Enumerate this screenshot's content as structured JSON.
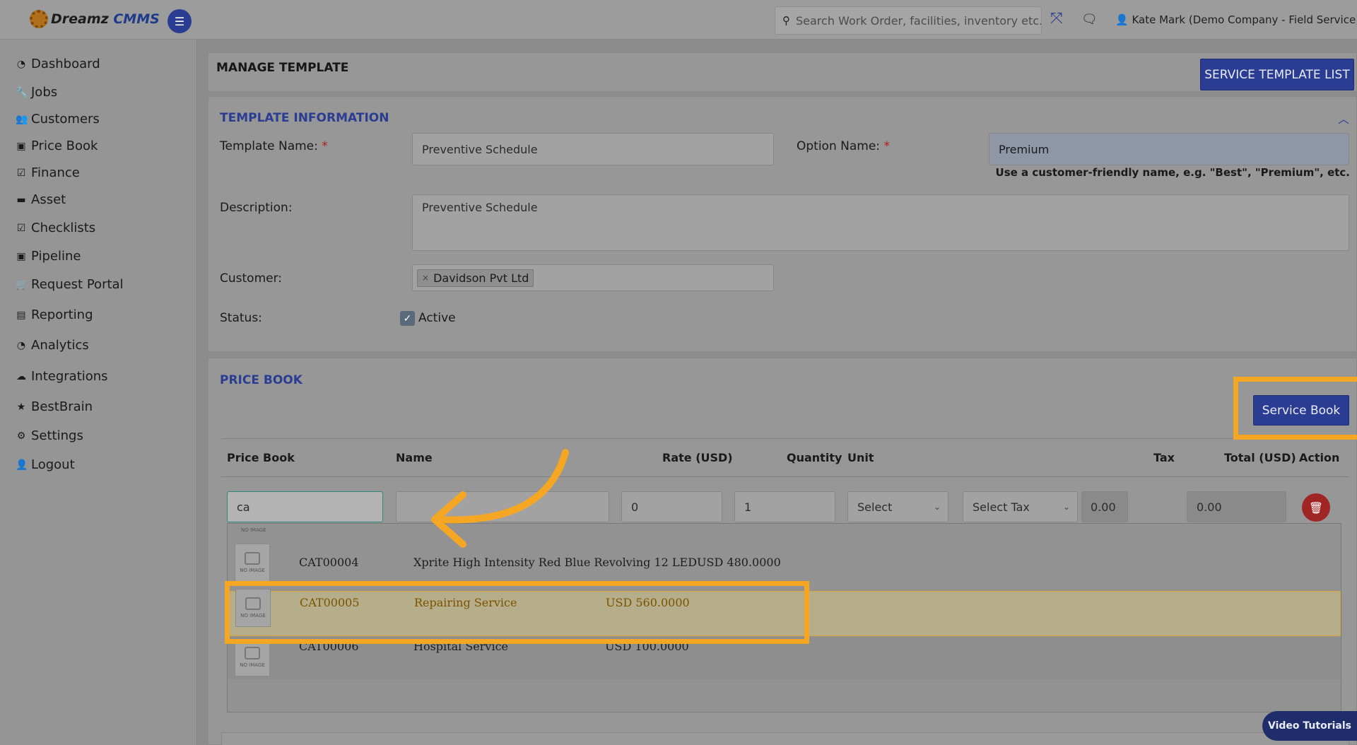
{
  "header": {
    "logo_main": "Dreamz",
    "logo_sub": "CMMS",
    "search_placeholder": "Search Work Order, facilities, inventory etc...",
    "user": "Kate Mark (Demo Company - Field Service)"
  },
  "sidebar": {
    "items": [
      {
        "label": "Dashboard",
        "icon": "dashboard-icon"
      },
      {
        "label": "Jobs",
        "icon": "wrench-icon"
      },
      {
        "label": "Customers",
        "icon": "users-icon"
      },
      {
        "label": "Price Book",
        "icon": "money-icon"
      },
      {
        "label": "Finance",
        "icon": "check-square-icon"
      },
      {
        "label": "Asset",
        "icon": "archive-icon"
      },
      {
        "label": "Checklists",
        "icon": "check-square-icon"
      },
      {
        "label": "Pipeline",
        "icon": "money-icon"
      },
      {
        "label": "Request Portal",
        "icon": "cart-icon"
      },
      {
        "label": "Reporting",
        "icon": "file-icon"
      },
      {
        "label": "Analytics",
        "icon": "dashboard-icon"
      },
      {
        "label": "Integrations",
        "icon": "cloud-icon"
      },
      {
        "label": "BestBrain",
        "icon": "star-icon"
      },
      {
        "label": "Settings",
        "icon": "gear-icon"
      },
      {
        "label": "Logout",
        "icon": "user-icon"
      }
    ]
  },
  "page": {
    "title": "MANAGE TEMPLATE",
    "list_button": "SERVICE TEMPLATE LIST"
  },
  "template_info": {
    "section_title": "TEMPLATE INFORMATION",
    "template_name_label": "Template Name:",
    "template_name_value": "Preventive Schedule",
    "option_name_label": "Option Name:",
    "option_name_value": "Premium",
    "option_hint": "Use a customer-friendly name, e.g. \"Best\", \"Premium\", etc.",
    "description_label": "Description:",
    "description_value": "Preventive Schedule",
    "customer_label": "Customer:",
    "customer_chip": "Davidson Pvt Ltd",
    "status_label": "Status:",
    "status_value": "Active",
    "required_mark": "*"
  },
  "price_book": {
    "section_title": "PRICE BOOK",
    "service_book_button": "Service Book",
    "columns": [
      "Price Book",
      "Name",
      "Rate (USD)",
      "Quantity",
      "Unit",
      "Tax",
      "Total (USD)",
      "Action"
    ],
    "row": {
      "price_book_input": "ca",
      "name_input": "",
      "rate": "0",
      "quantity": "1",
      "unit": "Select",
      "tax": "Select Tax",
      "tax_amount": "0.00",
      "total": "0.00"
    },
    "suggestions": [
      {
        "code": "CAT00004",
        "name": "Xprite High Intensity Red Blue Revolving 12 LED",
        "price": "USD 480.0000"
      },
      {
        "code": "CAT00005",
        "name": "Repairing Service",
        "price": "USD 560.0000"
      },
      {
        "code": "CAT00006",
        "name": "Hospital Service",
        "price": "USD 100.0000"
      }
    ],
    "no_image": "NO IMAGE"
  },
  "footer": {
    "video_button": "Video Tutorials"
  }
}
